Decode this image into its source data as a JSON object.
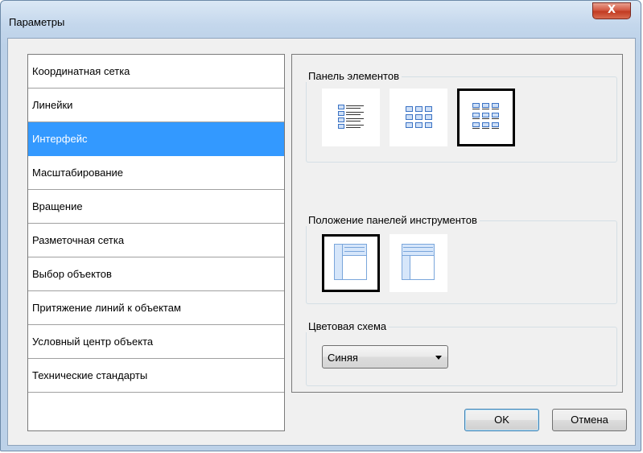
{
  "window": {
    "title": "Параметры",
    "close_label": "X"
  },
  "nav": {
    "items": [
      {
        "label": "Координатная сетка"
      },
      {
        "label": "Линейки"
      },
      {
        "label": "Интерфейс"
      },
      {
        "label": "Масштабирование"
      },
      {
        "label": "Вращение"
      },
      {
        "label": "Разметочная сетка"
      },
      {
        "label": "Выбор объектов"
      },
      {
        "label": "Притяжение линий к объектам"
      },
      {
        "label": "Условный центр объекта"
      },
      {
        "label": "Технические стандарты"
      }
    ],
    "selected_index": 2
  },
  "panel_elements": {
    "title": "Панель элементов",
    "options": [
      {
        "icon": "list-view-icon"
      },
      {
        "icon": "grid-view-icon"
      },
      {
        "icon": "grid-captions-view-icon"
      }
    ],
    "selected_index": 2
  },
  "toolbar_position": {
    "title": "Положение панелей инструментов",
    "options": [
      {
        "icon": "toolbar-left-layout-icon"
      },
      {
        "icon": "toolbar-top-layout-icon"
      }
    ],
    "selected_index": 0
  },
  "color_scheme": {
    "title": "Цветовая схема",
    "value": "Синяя"
  },
  "buttons": {
    "ok": "OK",
    "cancel": "Отмена"
  },
  "colors": {
    "selection": "#3399ff",
    "close_button": "#c23b22"
  }
}
